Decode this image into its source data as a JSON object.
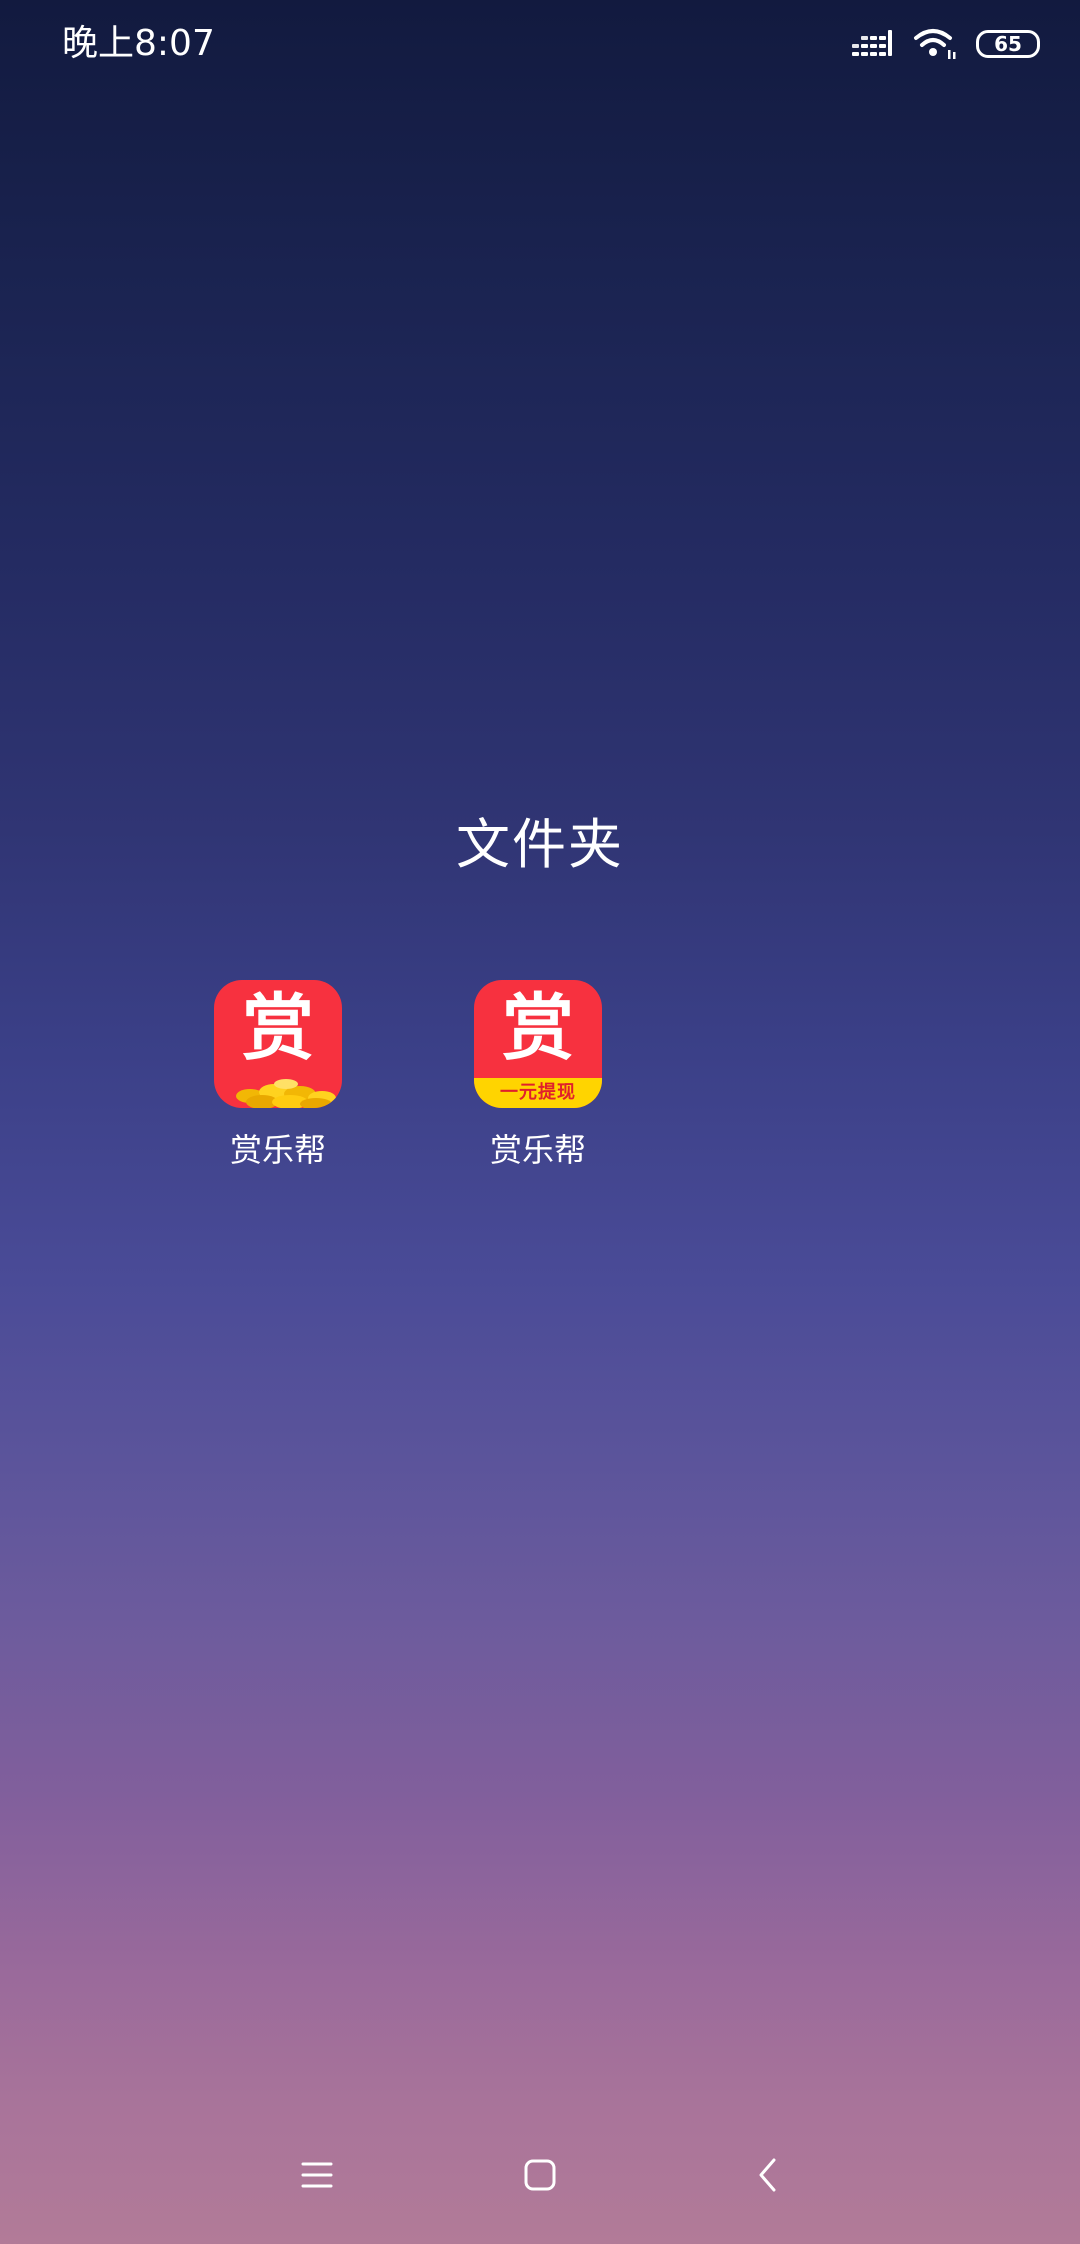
{
  "status_bar": {
    "time": "晚上8:07",
    "battery_level": "65",
    "icons": [
      "signal-icon",
      "wifi-icon",
      "battery-icon"
    ]
  },
  "folder": {
    "title": "文件夹",
    "apps": [
      {
        "label": "赏乐帮",
        "icon_glyph": "赏",
        "icon_variant": "coins",
        "icon_color": "#f7313f"
      },
      {
        "label": "赏乐帮",
        "icon_glyph": "赏",
        "icon_variant": "banner",
        "banner_text": "一元提现",
        "icon_color": "#f7313f"
      }
    ]
  },
  "nav_bar": {
    "buttons": [
      "menu-icon",
      "home-icon",
      "back-icon"
    ]
  },
  "colors": {
    "gradient_top": "#121a3f",
    "gradient_bottom": "#b27b98",
    "icon_red": "#f7313f",
    "banner_yellow": "#ffd400"
  }
}
